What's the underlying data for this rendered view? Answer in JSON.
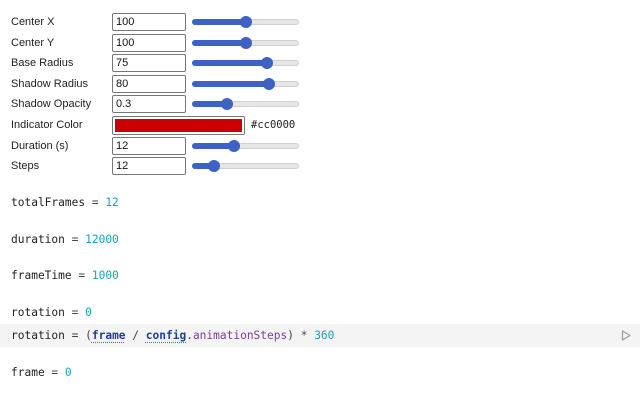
{
  "controls": [
    {
      "label": "Center X",
      "value": "100",
      "fraction": 0.5
    },
    {
      "label": "Center Y",
      "value": "100",
      "fraction": 0.5
    },
    {
      "label": "Base Radius",
      "value": "75",
      "fraction": 0.73
    },
    {
      "label": "Shadow Radius",
      "value": "80",
      "fraction": 0.75
    },
    {
      "label": "Shadow Opacity",
      "value": "0.3",
      "fraction": 0.3
    },
    {
      "label": "Indicator Color",
      "value": "#cc0000"
    },
    {
      "label": "Duration (s)",
      "value": "12",
      "fraction": 0.38
    },
    {
      "label": "Steps",
      "value": "12",
      "fraction": 0.17
    }
  ],
  "indicator_color": "#cc0000",
  "cells": {
    "c1": {
      "name": "totalFrames",
      "op": " = ",
      "value": "12"
    },
    "c2": {
      "name": "duration",
      "op": " = ",
      "value": "12000"
    },
    "c3": {
      "name": "frameTime",
      "op": " = ",
      "value": "1000"
    },
    "c4": {
      "name": "rotation",
      "op": " = ",
      "value": "0"
    },
    "c5": {
      "name": "rotation",
      "op": " = ",
      "open": "(",
      "ref1": "frame",
      "slash": " / ",
      "ref2": "config",
      "dot": ".",
      "prop": "animationSteps",
      "close": ") * ",
      "value": "360"
    },
    "c6": {
      "name": "frame",
      "op": " = ",
      "value": "0"
    }
  },
  "icons": {
    "run": "play-icon"
  },
  "colors": {
    "accent": "#3d62c4",
    "number": "#1aa1b8"
  }
}
